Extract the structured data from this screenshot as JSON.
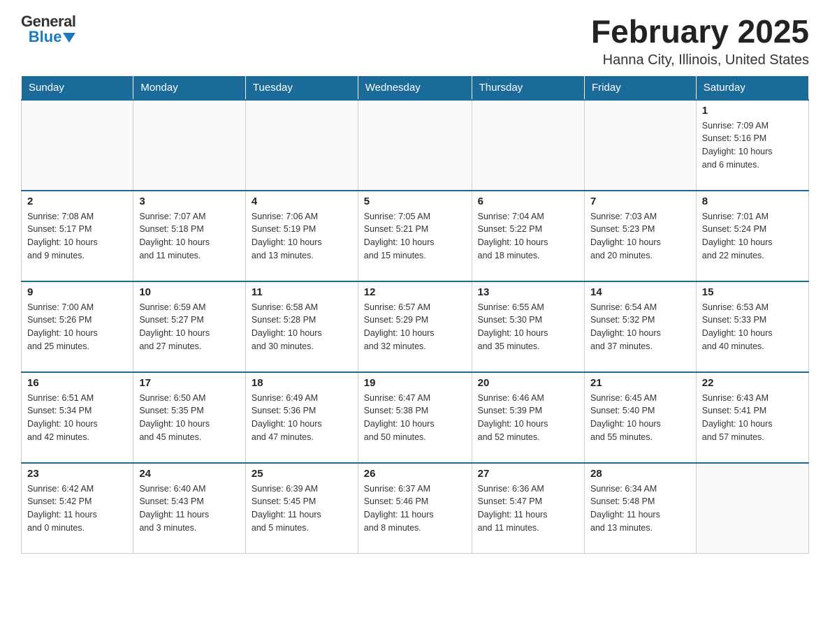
{
  "header": {
    "logo": {
      "general": "General",
      "blue": "Blue"
    },
    "title": "February 2025",
    "location": "Hanna City, Illinois, United States"
  },
  "weekdays": [
    "Sunday",
    "Monday",
    "Tuesday",
    "Wednesday",
    "Thursday",
    "Friday",
    "Saturday"
  ],
  "weeks": [
    [
      {
        "day": "",
        "info": ""
      },
      {
        "day": "",
        "info": ""
      },
      {
        "day": "",
        "info": ""
      },
      {
        "day": "",
        "info": ""
      },
      {
        "day": "",
        "info": ""
      },
      {
        "day": "",
        "info": ""
      },
      {
        "day": "1",
        "info": "Sunrise: 7:09 AM\nSunset: 5:16 PM\nDaylight: 10 hours\nand 6 minutes."
      }
    ],
    [
      {
        "day": "2",
        "info": "Sunrise: 7:08 AM\nSunset: 5:17 PM\nDaylight: 10 hours\nand 9 minutes."
      },
      {
        "day": "3",
        "info": "Sunrise: 7:07 AM\nSunset: 5:18 PM\nDaylight: 10 hours\nand 11 minutes."
      },
      {
        "day": "4",
        "info": "Sunrise: 7:06 AM\nSunset: 5:19 PM\nDaylight: 10 hours\nand 13 minutes."
      },
      {
        "day": "5",
        "info": "Sunrise: 7:05 AM\nSunset: 5:21 PM\nDaylight: 10 hours\nand 15 minutes."
      },
      {
        "day": "6",
        "info": "Sunrise: 7:04 AM\nSunset: 5:22 PM\nDaylight: 10 hours\nand 18 minutes."
      },
      {
        "day": "7",
        "info": "Sunrise: 7:03 AM\nSunset: 5:23 PM\nDaylight: 10 hours\nand 20 minutes."
      },
      {
        "day": "8",
        "info": "Sunrise: 7:01 AM\nSunset: 5:24 PM\nDaylight: 10 hours\nand 22 minutes."
      }
    ],
    [
      {
        "day": "9",
        "info": "Sunrise: 7:00 AM\nSunset: 5:26 PM\nDaylight: 10 hours\nand 25 minutes."
      },
      {
        "day": "10",
        "info": "Sunrise: 6:59 AM\nSunset: 5:27 PM\nDaylight: 10 hours\nand 27 minutes."
      },
      {
        "day": "11",
        "info": "Sunrise: 6:58 AM\nSunset: 5:28 PM\nDaylight: 10 hours\nand 30 minutes."
      },
      {
        "day": "12",
        "info": "Sunrise: 6:57 AM\nSunset: 5:29 PM\nDaylight: 10 hours\nand 32 minutes."
      },
      {
        "day": "13",
        "info": "Sunrise: 6:55 AM\nSunset: 5:30 PM\nDaylight: 10 hours\nand 35 minutes."
      },
      {
        "day": "14",
        "info": "Sunrise: 6:54 AM\nSunset: 5:32 PM\nDaylight: 10 hours\nand 37 minutes."
      },
      {
        "day": "15",
        "info": "Sunrise: 6:53 AM\nSunset: 5:33 PM\nDaylight: 10 hours\nand 40 minutes."
      }
    ],
    [
      {
        "day": "16",
        "info": "Sunrise: 6:51 AM\nSunset: 5:34 PM\nDaylight: 10 hours\nand 42 minutes."
      },
      {
        "day": "17",
        "info": "Sunrise: 6:50 AM\nSunset: 5:35 PM\nDaylight: 10 hours\nand 45 minutes."
      },
      {
        "day": "18",
        "info": "Sunrise: 6:49 AM\nSunset: 5:36 PM\nDaylight: 10 hours\nand 47 minutes."
      },
      {
        "day": "19",
        "info": "Sunrise: 6:47 AM\nSunset: 5:38 PM\nDaylight: 10 hours\nand 50 minutes."
      },
      {
        "day": "20",
        "info": "Sunrise: 6:46 AM\nSunset: 5:39 PM\nDaylight: 10 hours\nand 52 minutes."
      },
      {
        "day": "21",
        "info": "Sunrise: 6:45 AM\nSunset: 5:40 PM\nDaylight: 10 hours\nand 55 minutes."
      },
      {
        "day": "22",
        "info": "Sunrise: 6:43 AM\nSunset: 5:41 PM\nDaylight: 10 hours\nand 57 minutes."
      }
    ],
    [
      {
        "day": "23",
        "info": "Sunrise: 6:42 AM\nSunset: 5:42 PM\nDaylight: 11 hours\nand 0 minutes."
      },
      {
        "day": "24",
        "info": "Sunrise: 6:40 AM\nSunset: 5:43 PM\nDaylight: 11 hours\nand 3 minutes."
      },
      {
        "day": "25",
        "info": "Sunrise: 6:39 AM\nSunset: 5:45 PM\nDaylight: 11 hours\nand 5 minutes."
      },
      {
        "day": "26",
        "info": "Sunrise: 6:37 AM\nSunset: 5:46 PM\nDaylight: 11 hours\nand 8 minutes."
      },
      {
        "day": "27",
        "info": "Sunrise: 6:36 AM\nSunset: 5:47 PM\nDaylight: 11 hours\nand 11 minutes."
      },
      {
        "day": "28",
        "info": "Sunrise: 6:34 AM\nSunset: 5:48 PM\nDaylight: 11 hours\nand 13 minutes."
      },
      {
        "day": "",
        "info": ""
      }
    ]
  ]
}
